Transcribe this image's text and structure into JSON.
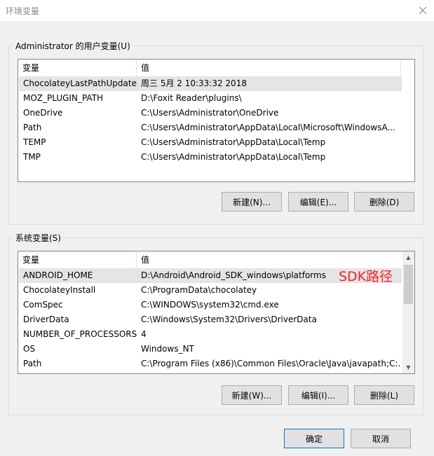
{
  "window": {
    "title": "环境变量",
    "close_icon": "close-icon"
  },
  "user_vars": {
    "group_label": "Administrator 的用户变量(U)",
    "columns": [
      "变量",
      "值"
    ],
    "rows": [
      {
        "name": "ChocolateyLastPathUpdate",
        "value": "周三 5月  2 10:33:32 2018",
        "selected": true
      },
      {
        "name": "MOZ_PLUGIN_PATH",
        "value": "D:\\Foxit Reader\\plugins\\"
      },
      {
        "name": "OneDrive",
        "value": "C:\\Users\\Administrator\\OneDrive"
      },
      {
        "name": "Path",
        "value": "C:\\Users\\Administrator\\AppData\\Local\\Microsoft\\WindowsA..."
      },
      {
        "name": "TEMP",
        "value": "C:\\Users\\Administrator\\AppData\\Local\\Temp"
      },
      {
        "name": "TMP",
        "value": "C:\\Users\\Administrator\\AppData\\Local\\Temp"
      }
    ],
    "buttons": {
      "new": "新建(N)...",
      "edit": "编辑(E)...",
      "delete": "删除(D)"
    }
  },
  "system_vars": {
    "group_label": "系统变量(S)",
    "columns": [
      "变量",
      "值"
    ],
    "rows": [
      {
        "name": "ANDROID_HOME",
        "value": "D:\\Android\\Android_SDK_windows\\platforms",
        "selected": true
      },
      {
        "name": "ChocolateyInstall",
        "value": "C:\\ProgramData\\chocolatey"
      },
      {
        "name": "ComSpec",
        "value": "C:\\WINDOWS\\system32\\cmd.exe"
      },
      {
        "name": "DriverData",
        "value": "C:\\Windows\\System32\\Drivers\\DriverData"
      },
      {
        "name": "NUMBER_OF_PROCESSORS",
        "value": "4"
      },
      {
        "name": "OS",
        "value": "Windows_NT"
      },
      {
        "name": "Path",
        "value": "C:\\Program Files (x86)\\Common Files\\Oracle\\Java\\javapath;C:..."
      }
    ],
    "buttons": {
      "new": "新建(W)...",
      "edit": "编辑(I)...",
      "delete": "删除(L)"
    }
  },
  "annotation": "SDK路径",
  "footer": {
    "ok": "确定",
    "cancel": "取消"
  },
  "colors": {
    "selection": "#e5e5e5",
    "annotation": "#ff2020",
    "default_button_border": "#0078d7"
  }
}
